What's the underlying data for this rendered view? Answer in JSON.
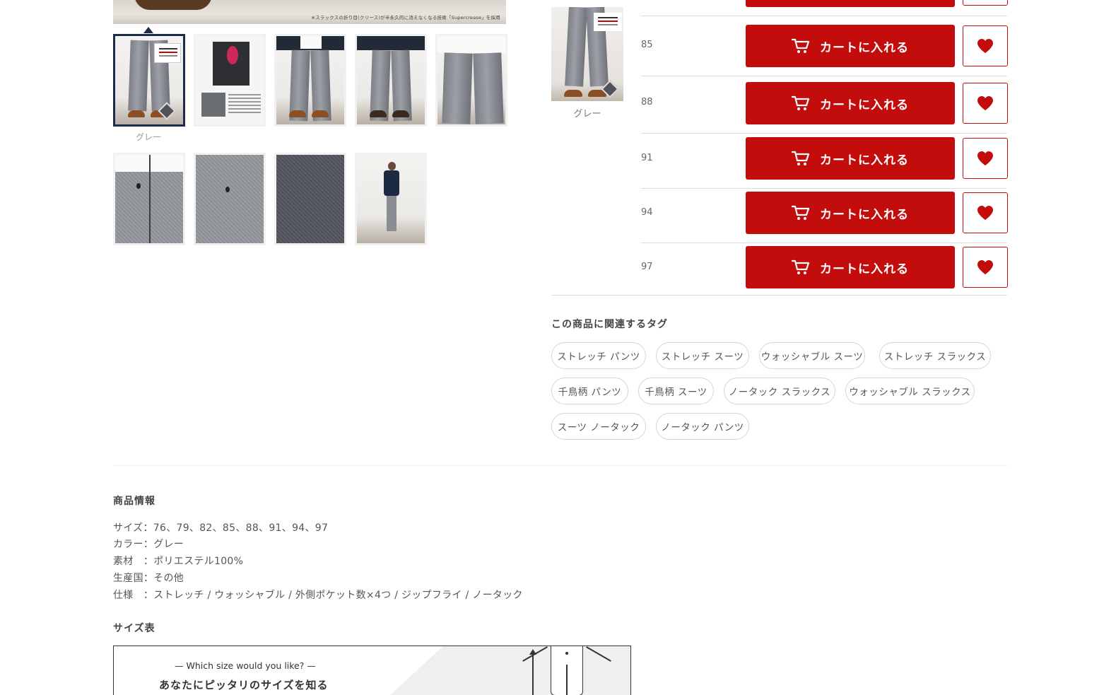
{
  "gallery": {
    "main_caption": "※スラックスの折り目(クリース)が半永久的に消えなくなる技術「Supercrease」を採用",
    "selected_color_label": "グレー"
  },
  "color_swatch": {
    "label": "グレー"
  },
  "sizes": [
    {
      "size": "85",
      "cart_label": "カートに入れる"
    },
    {
      "size": "88",
      "cart_label": "カートに入れる"
    },
    {
      "size": "91",
      "cart_label": "カートに入れる"
    },
    {
      "size": "94",
      "cart_label": "カートに入れる"
    },
    {
      "size": "97",
      "cart_label": "カートに入れる"
    }
  ],
  "tags": {
    "title": "この商品に関連するタグ",
    "items": [
      "ストレッチ パンツ",
      "ストレッチ スーツ",
      "ウォッシャブル スーツ",
      "ストレッチ スラックス",
      "千鳥柄 パンツ",
      "千鳥柄 スーツ",
      "ノータック スラックス",
      "ウォッシャブル スラックス",
      "スーツ ノータック",
      "ノータック パンツ"
    ]
  },
  "product_info": {
    "heading": "商品情報",
    "lines": [
      "サイズ：76、79、82、85、88、91、94、97",
      "カラー：グレー",
      "素材　：ポリエステル100%",
      "生産国：その他",
      "仕様　：ストレッチ / ウォッシャブル / 外側ポケット数×4つ / ジップフライ / ノータック"
    ]
  },
  "size_chart": {
    "heading": "サイズ表",
    "english": "— Which size would you like? —",
    "japanese": "あなたにピッタリのサイズを知る"
  },
  "colors": {
    "accent": "#c30d0d",
    "selected_border": "#1e2a4a"
  }
}
